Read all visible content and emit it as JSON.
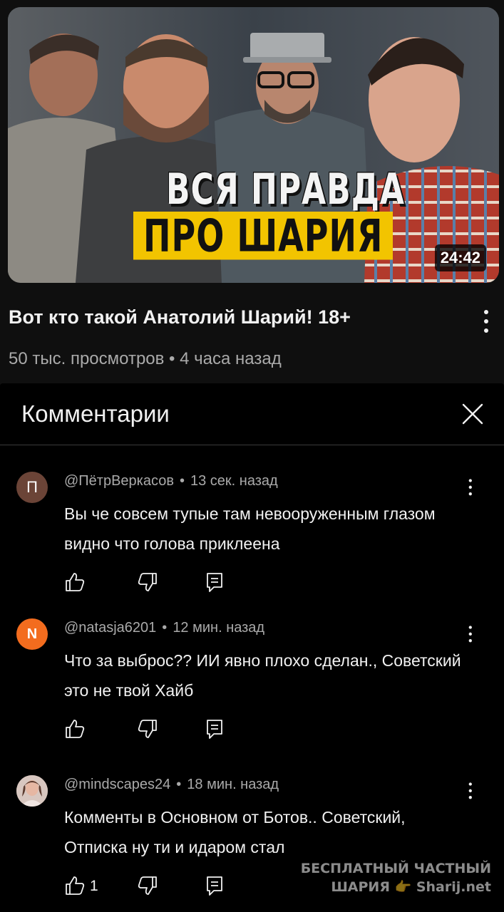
{
  "video": {
    "thumbnail_line1": "ВСЯ ПРАВДА",
    "thumbnail_line2": "ПРО ШАРИЯ",
    "duration": "24:42",
    "title": "Вот кто такой Анатолий Шарий! 18+",
    "meta": "50 тыс. просмотров • 4 часа назад",
    "more_icon": "more-vertical-icon"
  },
  "comments_panel": {
    "title": "Комментарии",
    "close_icon": "close-icon",
    "items": [
      {
        "avatar_letter": "П",
        "avatar_color": "#6b4437",
        "author": "@ПётрВеркасов",
        "time": "13 сек. назад",
        "text": "Вы че совсем тупые там невооруженным глазом видно что голова приклеена",
        "likes": ""
      },
      {
        "avatar_letter": "N",
        "avatar_color": "#f36c1e",
        "author": "@natasja6201",
        "time": "12 мин. назад",
        "text": "Что за выброс?? ИИ явно плохо сделан., Советский это не твой Хайб",
        "likes": ""
      },
      {
        "avatar_letter": "",
        "avatar_color": "#c9b6ae",
        "author": "@mindscapes24",
        "time": "18 мин. назад",
        "text": "Комменты в Основном от Ботов.. Советский, Отписка ну ти  и идаром стал",
        "likes": "1"
      }
    ]
  },
  "watermark": {
    "line1": "БЕСПЛАТНЫЙ ЧАСТНЫЙ",
    "line2": "ШАРИЯ 👉 Sharij.net"
  }
}
